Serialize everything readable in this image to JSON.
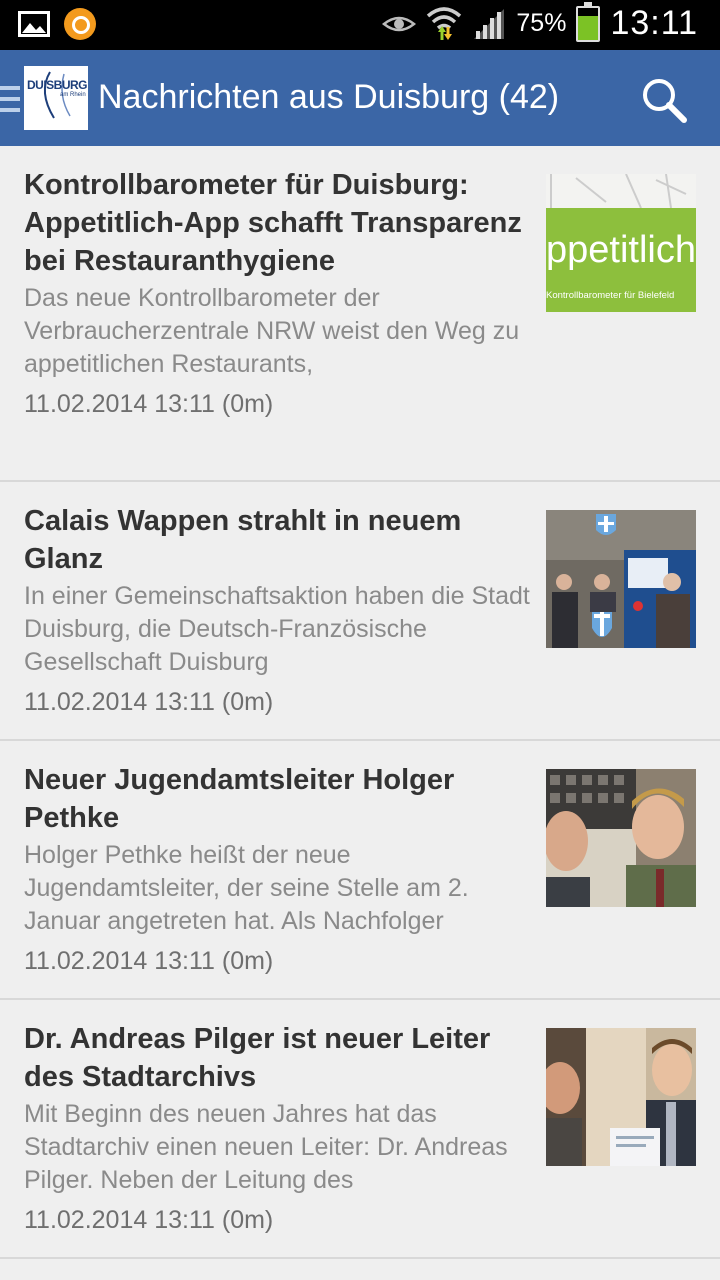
{
  "status_bar": {
    "battery_percent": "75%",
    "battery_level": 0.75,
    "time": "13:11",
    "icons": [
      "gallery-icon",
      "app-notification-icon",
      "eye-icon",
      "wifi-icon",
      "signal-icon",
      "battery-icon"
    ]
  },
  "action_bar": {
    "title": "Nachrichten aus Duisburg (42)",
    "logo_text": "DUISBURG",
    "logo_subtext": "am Rhein",
    "color": "#3b66a6"
  },
  "news": [
    {
      "headline": "Kontrollbarometer für Duisburg: Appetitlich-App schafft Transparenz bei Restauranthygiene",
      "summary": "Das neue Kontrollbarometer der Verbraucherzentrale NRW weist den Weg zu appetitlichen Restaurants,",
      "date": "11.02.2014 13:11 (0m)",
      "thumb_text": "ppetitlich",
      "thumb_subtext": "Kontrollbarometer für Bielefeld"
    },
    {
      "headline": "Calais Wappen strahlt in neuem Glanz",
      "summary": "In einer Gemeinschaftsaktion haben die Stadt Duisburg, die Deutsch-Französische Gesellschaft Duisburg",
      "date": "11.02.2014 13:11 (0m)"
    },
    {
      "headline": "Neuer Jugendamtsleiter Holger Pethke",
      "summary": "Holger Pethke heißt der neue Jugendamtsleiter, der seine Stelle am 2. Januar angetreten hat. Als Nachfolger",
      "date": "11.02.2014 13:11 (0m)"
    },
    {
      "headline": "Dr. Andreas Pilger ist neuer Leiter des Stadtarchivs",
      "summary": "Mit Beginn des neuen Jahres hat das Stadtarchiv einen neuen Leiter: Dr. Andreas Pilger. Neben der Leitung des",
      "date": "11.02.2014 13:11 (0m)"
    }
  ]
}
